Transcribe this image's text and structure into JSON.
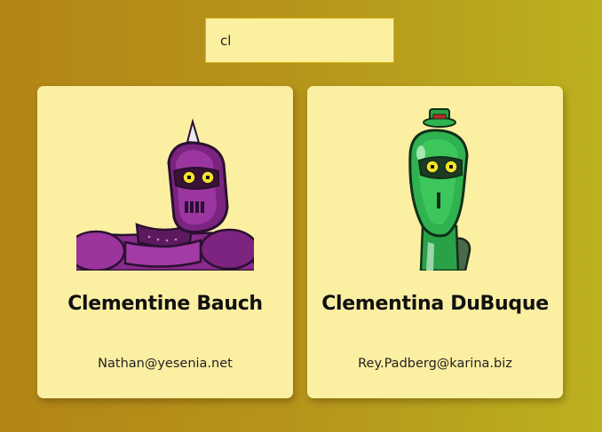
{
  "search": {
    "value": "cl"
  },
  "cards": [
    {
      "name": "Clementine Bauch",
      "email": "Nathan@yesenia.net",
      "avatar_icon": "purple-robot-avatar"
    },
    {
      "name": "Clementina DuBuque",
      "email": "Rey.Padberg@karina.biz",
      "avatar_icon": "green-robot-avatar"
    }
  ],
  "colors": {
    "card_background": "#fbefa2",
    "search_background": "#fbefa0",
    "search_border": "#d9b414",
    "background_start": "#b28516",
    "background_end": "#bcb11f"
  }
}
